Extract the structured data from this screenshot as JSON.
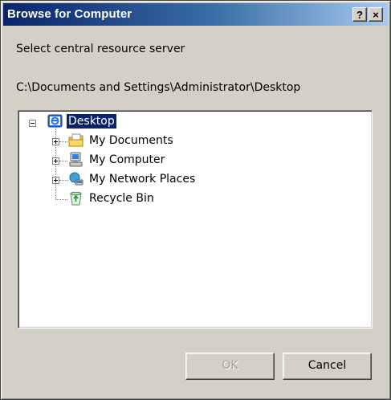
{
  "window": {
    "title": "Browse for Computer",
    "help_glyph": "?",
    "close_glyph": "×"
  },
  "prompt": "Select central resource server",
  "current_path": "C:\\Documents and Settings\\Administrator\\Desktop",
  "tree": {
    "root": {
      "label": "Desktop",
      "icon": "desktop-icon",
      "expanded": true,
      "selected": true
    },
    "children": [
      {
        "label": "My Documents",
        "icon": "my-documents-icon",
        "expandable": true
      },
      {
        "label": "My Computer",
        "icon": "my-computer-icon",
        "expandable": true
      },
      {
        "label": "My Network Places",
        "icon": "network-places-icon",
        "expandable": true
      },
      {
        "label": "Recycle Bin",
        "icon": "recycle-bin-icon",
        "expandable": false
      }
    ]
  },
  "buttons": {
    "ok_label": "OK",
    "ok_enabled": false,
    "cancel_label": "Cancel"
  },
  "colors": {
    "titlebar_start": "#0a246a",
    "titlebar_end": "#a6caf0",
    "dialog_bg": "#d4d0c8",
    "selection": "#0a246a"
  }
}
